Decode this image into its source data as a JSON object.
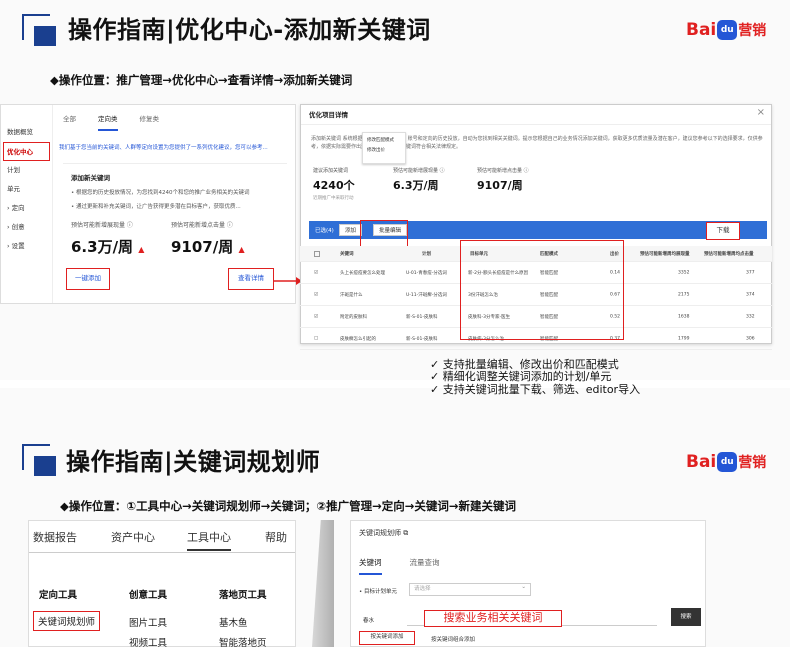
{
  "slide1": {
    "title": "操作指南|优化中心-添加新关键词",
    "logo": {
      "bai": "Bai",
      "du": "du",
      "ying": "营销"
    },
    "subtitle": "◆操作位置：推广管理→优化中心→查看详情→添加新关键词",
    "left_panel": {
      "nav": [
        "数据概览",
        "优化中心",
        "计划",
        "单元",
        "› 定向",
        "› 创意",
        "› 设置"
      ],
      "tabs": [
        "全部",
        "定向类",
        "修复类"
      ],
      "notice": "我们基于您当前的关键词、人群等定向设置为您提供了一系列优化建议，您可以参考...",
      "card_title": "添加新关键词",
      "card_lines": [
        "• 根据您的历史投放情况，为您找到4240个和您的推广业务相关的关键词",
        "• 通过更新和补充关键词，让广告获得更多潜在目标客户，获取优质..."
      ],
      "stat1_label": "预估可能新增展现量 ⓘ",
      "stat1_value": "6.3万/周",
      "stat2_label": "预估可能新增点击量 ⓘ",
      "stat2_value": "9107/周",
      "arrow": "▲",
      "btn_add": "一键添加",
      "btn_detail": "查看详情"
    },
    "dialog": {
      "title": "优化项目详情",
      "close": "×",
      "desc": "添加新关键词  系统根据账户中的推广业务、账号和定向的历史投放，自动为您找到相关关键词。提示您根据自己的业务情况添加关键词，获取更多优质流量及潜在客户，建议您参考以下的选择要求，仅供参考，依据实际需要作出选择，以确保您的关键词符合相关法律规定。",
      "stats": [
        {
          "label": "建议添加关键词",
          "value": "4240个",
          "sub": "近期推广中采取行动"
        },
        {
          "label": "预估可能新增展现量 ⓘ",
          "value": "6.3万/周",
          "sub": ""
        },
        {
          "label": "预估可能新增点击量 ⓘ",
          "value": "9107/周",
          "sub": ""
        }
      ],
      "toolbar": {
        "selected": "已选(4)",
        "add": "添加",
        "bulk": "批量编辑"
      },
      "dropdown": [
        "修改匹配模式",
        "修改出价"
      ],
      "download": "下载",
      "columns": [
        "关键词",
        "计划",
        "目标单元",
        "匹配模式",
        "出价",
        "预估可能新增周均展现量",
        "预估可能新增周均点击量"
      ],
      "rows": [
        {
          "checked": "☑",
          "kw": "头上长痘痘要怎么处理",
          "plan": "U-01-青春痘-分选词",
          "unit": "新-2分-额头长痘痘是什么原因",
          "match": "智能匹配",
          "bid": "0.14",
          "imp": "3352",
          "clk": "377"
        },
        {
          "checked": "☑",
          "kw": "汗斑是什么",
          "plan": "U-11-汗斑癣-分选词",
          "unit": "3份汗斑怎么治",
          "match": "智能匹配",
          "bid": "0.67",
          "imp": "2175",
          "clk": "374"
        },
        {
          "checked": "☑",
          "kw": "附近的皮肤科",
          "plan": "新-S-01-皮肤科",
          "unit": "皮肤科-3分专家-医生",
          "match": "智能匹配",
          "bid": "0.52",
          "imp": "1638",
          "clk": "332"
        },
        {
          "checked": "☐",
          "kw": "皮肤癣怎么引起的",
          "plan": "新-S-01-皮肤科",
          "unit": "皮肤病-3分怎么治",
          "match": "智能匹配",
          "bid": "0.37",
          "imp": "1799",
          "clk": "306"
        }
      ]
    },
    "features": [
      "✓ 支持批量编辑、修改出价和匹配模式",
      "✓ 精细化调整关键词添加的计划/单元",
      "✓ 支持关键词批量下载、筛选、editor导入"
    ]
  },
  "slide2": {
    "title": "操作指南|关键词规划师",
    "logo": {
      "bai": "Bai",
      "du": "du",
      "ying": "营销"
    },
    "subtitle": "◆操作位置：①工具中心→关键词规划师→关键词；②推广管理→定向→关键词→新建关键词",
    "left_menu": {
      "top": [
        "数据报告",
        "资产中心",
        "工具中心",
        "帮助"
      ],
      "col1": [
        "定向工具",
        "关键词规划师"
      ],
      "col2": [
        "创意工具",
        "图片工具",
        "视频工具"
      ],
      "col3": [
        "落地页工具",
        "基木鱼",
        "智能落地页"
      ]
    },
    "right_panel": {
      "header": "关键词规划师 ⧉",
      "tabs": [
        "关键词",
        "流量查询"
      ],
      "unit_label": "• 目标计划单元",
      "unit_placeholder": "请选择",
      "unit_chevron": "⌄",
      "seed_label": "春水",
      "search": "搜索",
      "subtab1": "按关键词添加",
      "subtab2": "按关键词组合添加"
    },
    "callout": "搜索业务相关关键词"
  }
}
